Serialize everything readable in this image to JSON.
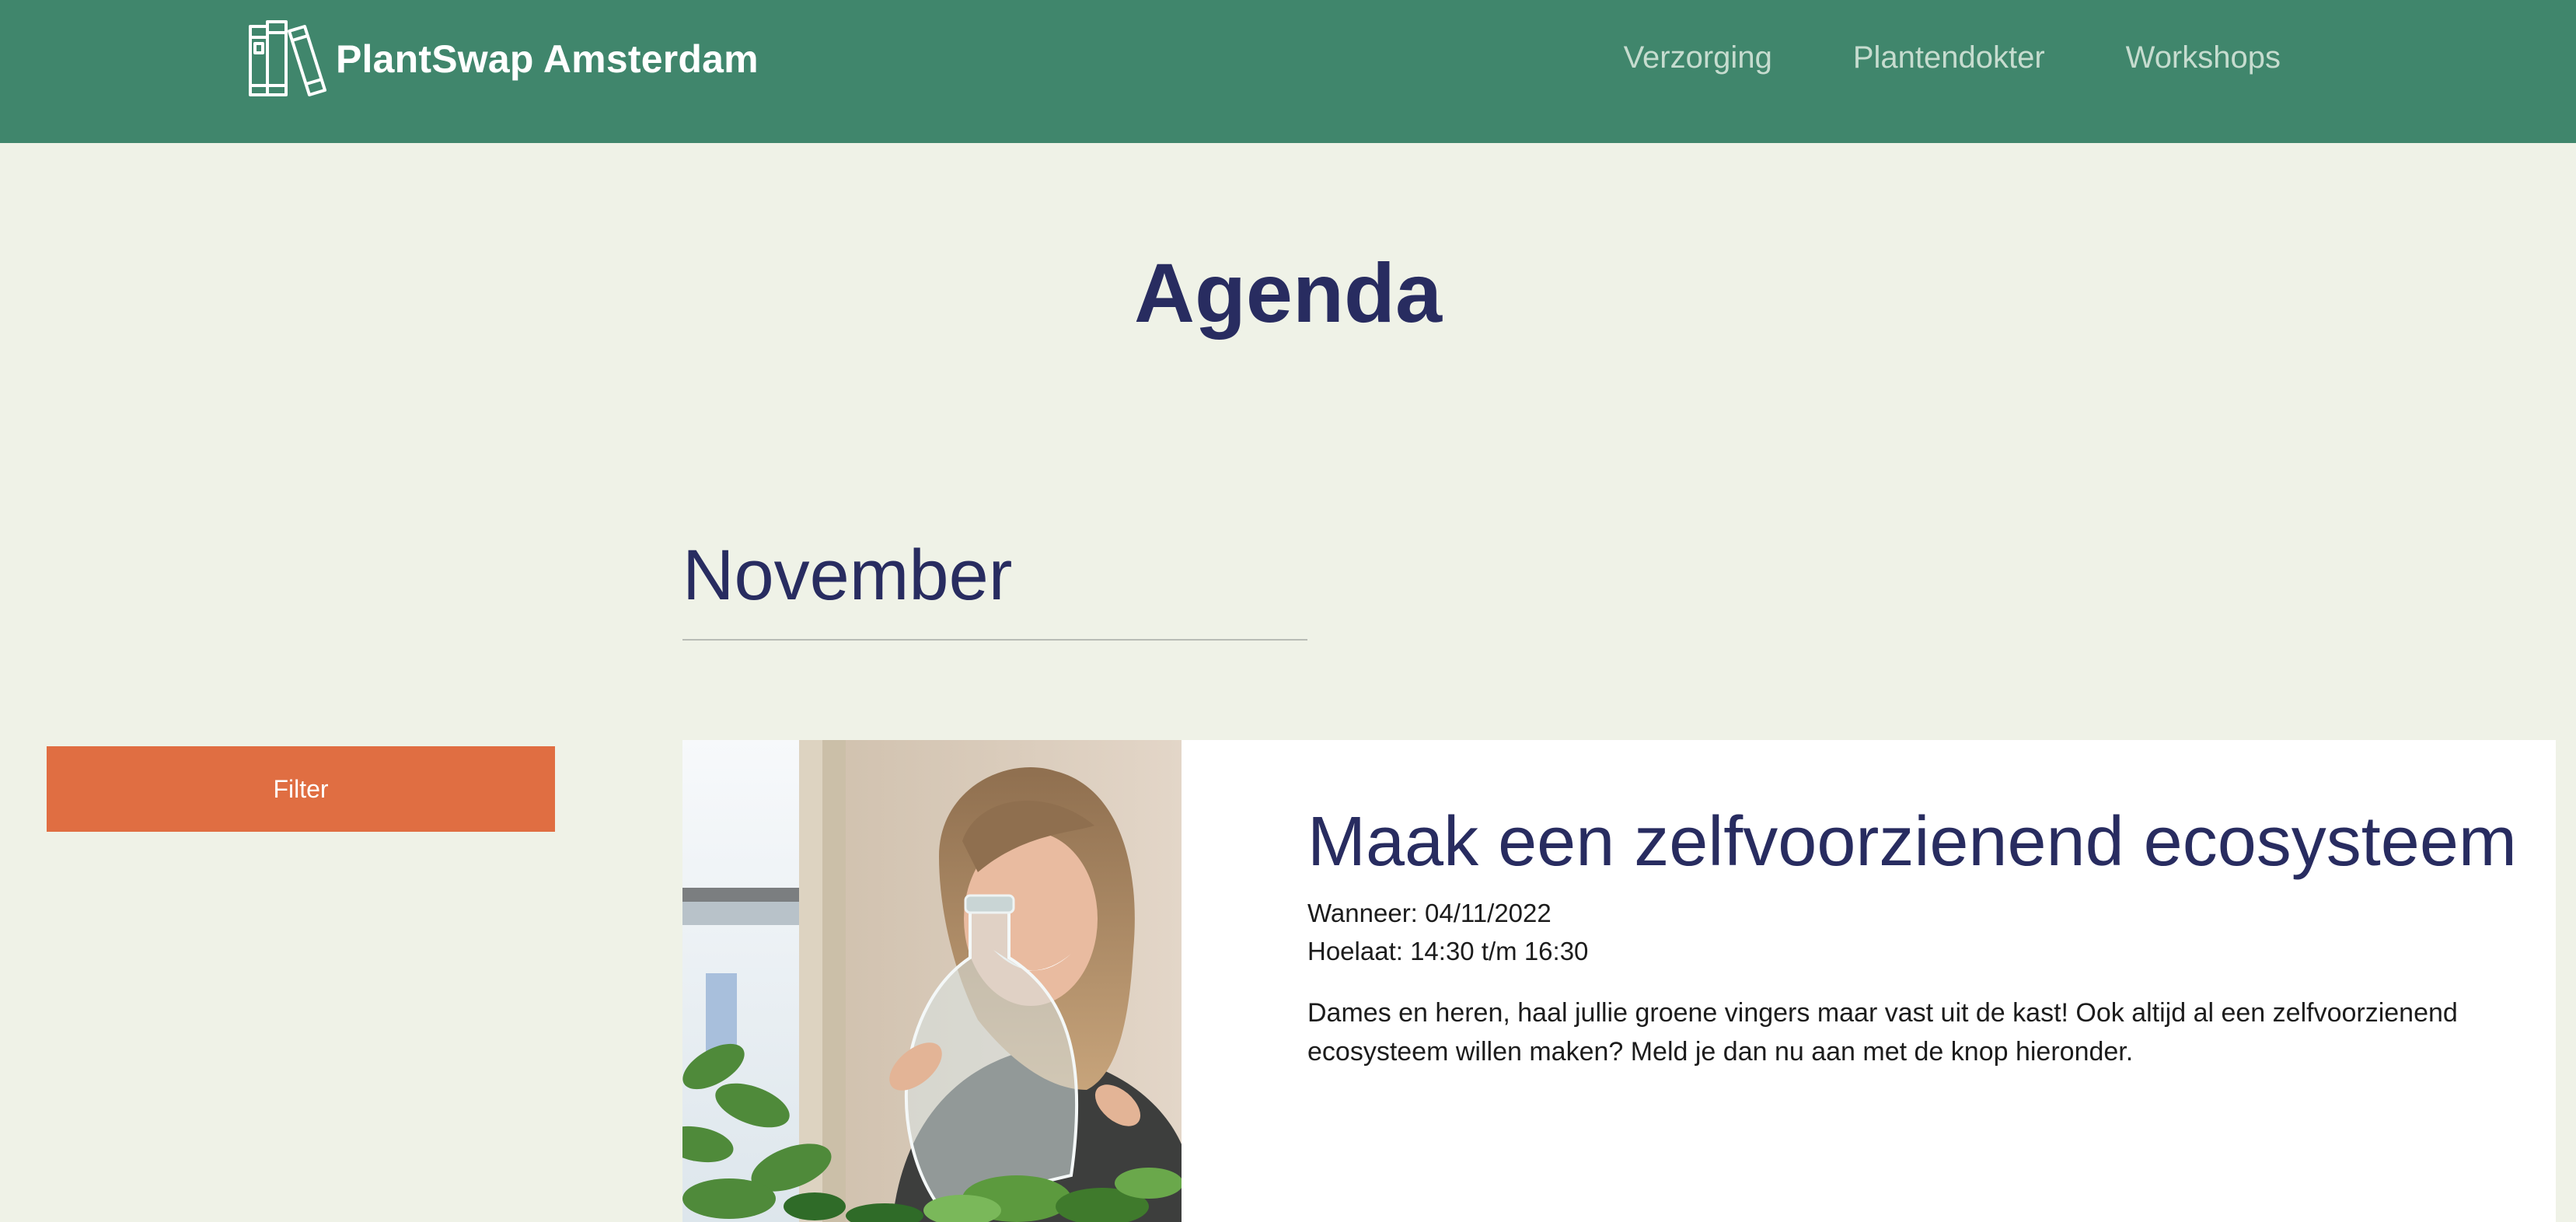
{
  "header": {
    "brand": "PlantSwap Amsterdam",
    "logo_icon": "books-icon",
    "background": "#40866c",
    "nav": [
      {
        "label": "Verzorging"
      },
      {
        "label": "Plantendokter"
      },
      {
        "label": "Workshops"
      }
    ]
  },
  "page": {
    "title": "Agenda",
    "background": "#eff2e7",
    "accent": "#282c60"
  },
  "month": "November",
  "filter": {
    "label": "Filter",
    "color": "#e06e42"
  },
  "events": [
    {
      "title": "Maak een zelfvoorzienend ecosysteem",
      "when": "Wanneer: 04/11/2022",
      "time": "Hoelaat: 14:30 t/m 16:30",
      "description": "Dames en heren, haal jullie groene vingers maar vast uit de kast! Ook altijd al een zelfvoorzienend ecosysteem willen maken? Meld je dan nu aan met de knop hieronder."
    }
  ]
}
